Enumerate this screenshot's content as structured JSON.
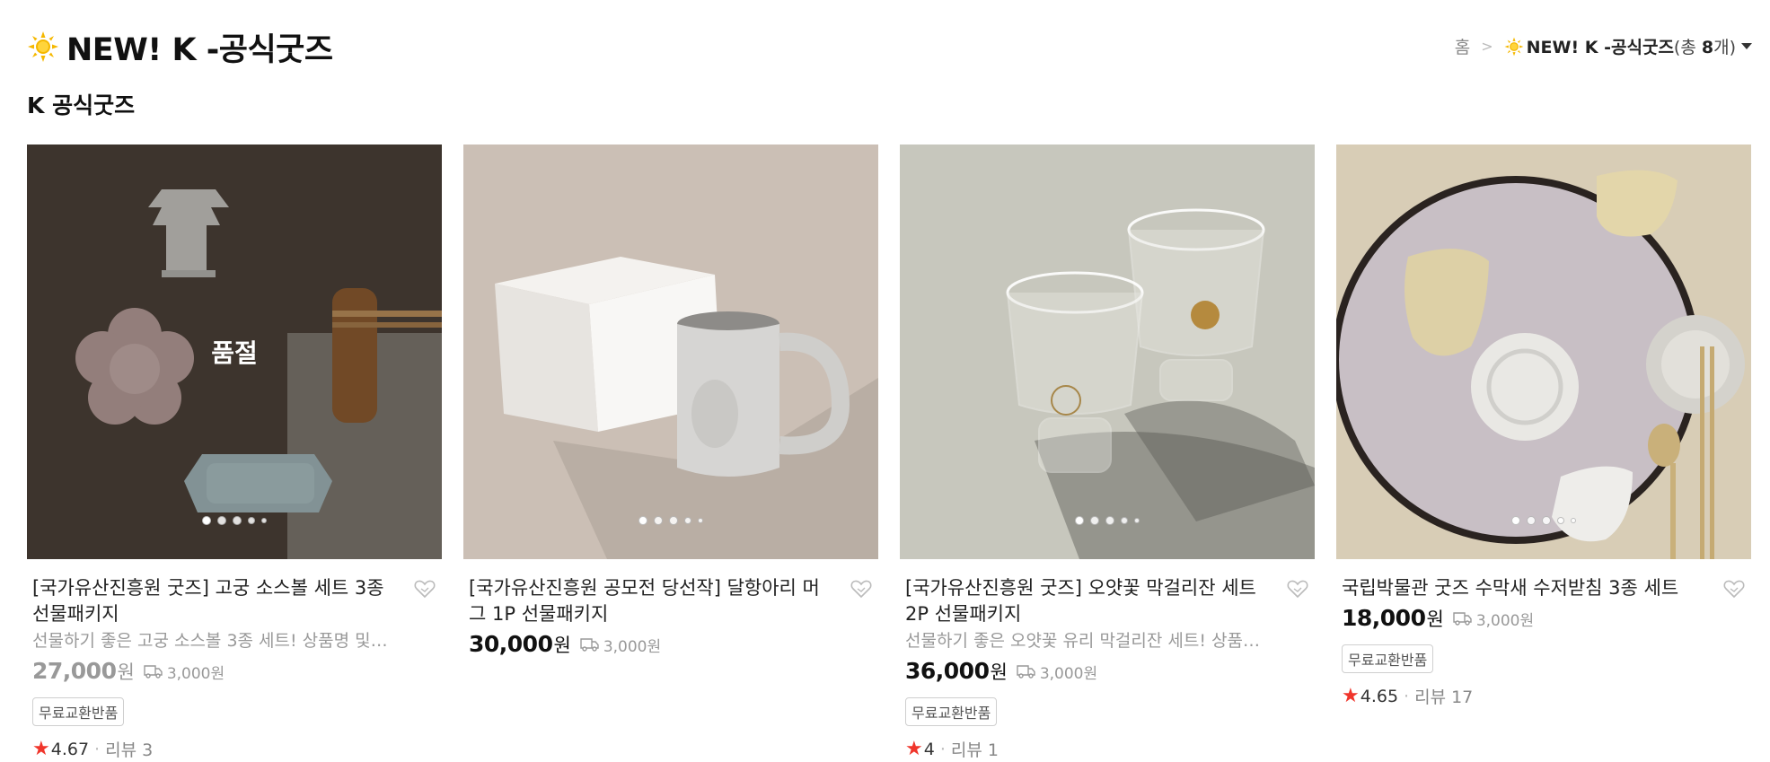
{
  "header": {
    "title": "NEW! K -공식굿즈",
    "icon": "sun-icon"
  },
  "breadcrumb": {
    "home": "홈",
    "separator": ">",
    "current": "NEW! K -공식굿즈",
    "count_prefix": "(총 ",
    "count": "8",
    "count_suffix": "개)"
  },
  "section": {
    "title": "K 공식굿즈"
  },
  "colors": {
    "accent_star": "#f0352b",
    "muted_text": "#999999"
  },
  "products": [
    {
      "name": "[국가유산진흥원 굿즈] 고궁 소스볼 세트 3종 선물패키지",
      "desc": "선물하기 좋은 고궁 소스볼 3종 세트! 상품명 및 ...",
      "price": "27,000",
      "won": "원",
      "shipping": "3,000원",
      "badge": "무료교환반품",
      "rating": "4.67",
      "review_label": "리뷰 3",
      "soldout": "품절"
    },
    {
      "name": "[국가유산진흥원 공모전 당선작] 달항아리 머그 1P 선물패키지",
      "price": "30,000",
      "won": "원",
      "shipping": "3,000원"
    },
    {
      "name": "[국가유산진흥원 굿즈] 오얏꽃 막걸리잔 세트 2P 선물패키지",
      "desc": "선물하기 좋은 오얏꽃 유리 막걸리잔 세트! 상품명...",
      "price": "36,000",
      "won": "원",
      "shipping": "3,000원",
      "badge": "무료교환반품",
      "rating": "4",
      "review_label": "리뷰 1"
    },
    {
      "name": "국립박물관 굿즈 수막새 수저받침 3종 세트",
      "price": "18,000",
      "won": "원",
      "shipping": "3,000원",
      "badge": "무료교환반품",
      "rating": "4.65",
      "review_label": "리뷰 17"
    }
  ]
}
